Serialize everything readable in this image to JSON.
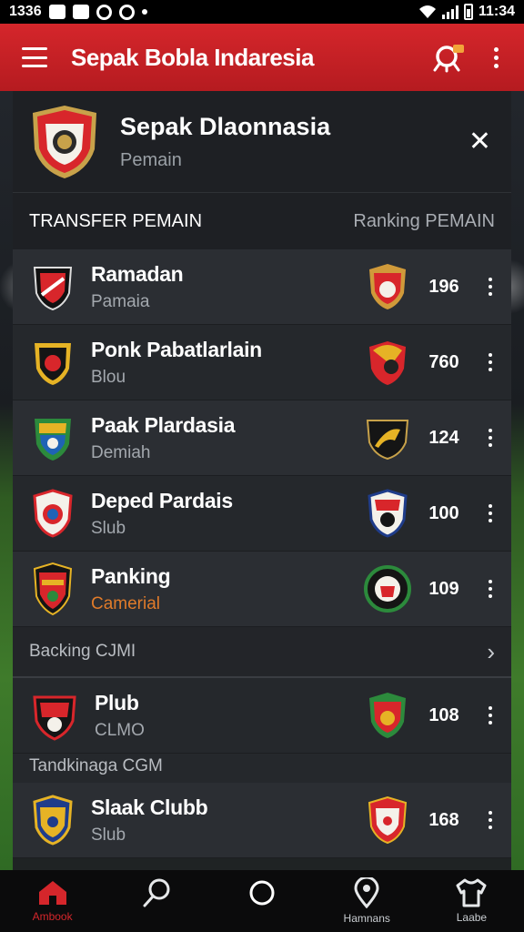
{
  "status_bar": {
    "time_left": "1336",
    "time_right": "11:34"
  },
  "app_bar": {
    "title": "Sepak Bobla Indaresia",
    "menu_icon": "hamburger-icon",
    "whistle_icon": "whistle-icon",
    "more_icon": "more-vert-icon",
    "accent": "#d5262b"
  },
  "panel": {
    "title": "Sepak Dlaonnasia",
    "subtitle": "Pemain",
    "close_label": "✕",
    "section_left": "TRANSFER PEMAIN",
    "section_right": "Ranking PEMAIN"
  },
  "rows": [
    {
      "name": "Ramadan",
      "sub": "Pamaia",
      "value": "196"
    },
    {
      "name": "Ponk Pabatlarlain",
      "sub": "Blou",
      "value": "760"
    },
    {
      "name": "Paak Plardasia",
      "sub": "Demiah",
      "value": "124"
    },
    {
      "name": "Deped Pardais",
      "sub": "Slub",
      "value": "100"
    },
    {
      "name": "Panking",
      "sub": "Camerial",
      "value": "109"
    }
  ],
  "ranking_bar": {
    "label": "Backing CJMI",
    "chevron": "›"
  },
  "rows2": [
    {
      "name": "Plub",
      "sub": "CLMO",
      "value": "108"
    }
  ],
  "caption": "Tandkinaga CGM",
  "rows3": [
    {
      "name": "Slaak Clubb",
      "sub": "Slub",
      "value": "168"
    }
  ],
  "bottom_nav": [
    {
      "label": "Ambook",
      "icon": "home-icon"
    },
    {
      "label": "",
      "icon": "search-icon"
    },
    {
      "label": "",
      "icon": "circle-icon"
    },
    {
      "label": "Hamnans",
      "icon": "location-icon"
    },
    {
      "label": "Laabe",
      "icon": "shirt-icon"
    }
  ]
}
